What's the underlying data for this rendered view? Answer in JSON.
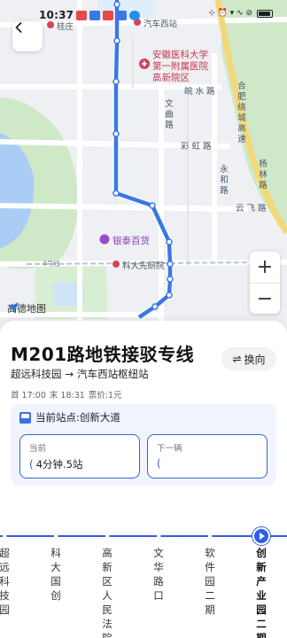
{
  "status_bar": {
    "time": "10:37",
    "right_text": "⊹ ⏰ ▾ ∿ ⊘"
  },
  "map": {
    "labels": {
      "guizhuang": "桂庄",
      "qiche_xizhan": "汽车西站",
      "hospital_line1": "安徽医科大学",
      "hospital_line2": "第一附属医院",
      "hospital_line3": "高新院区",
      "wanshui_road": "皖 水 路",
      "wenqu_road": "文曲路",
      "caihong_road": "彩 虹 路",
      "yonghe_road": "永和路",
      "hefei_ring": "合肥绕城高速",
      "yanglin_road": "杨林路",
      "yunfei_road": "云 飞 路",
      "yintai": "银泰百货",
      "kedaxian": "科大先研院",
      "line4": "4号线"
    },
    "logo_text": "高德地图",
    "zoom_in": "+",
    "zoom_out": "−"
  },
  "colors": {
    "route": "#3a78e6",
    "accent": "#2f5ee0",
    "park": "#cfe9c8",
    "water": "#a9cdf5",
    "highway": "#f3d878"
  },
  "route": {
    "title": "M201路地铁接驳专线",
    "switch_label": "换向",
    "switch_icon": "⇌",
    "from": "超远科技园",
    "arrow": "→",
    "to": "汽车西站枢纽站",
    "first_bus": "首 17:00",
    "last_bus": "末 18:31",
    "fare": "票价:1元"
  },
  "current_station": {
    "label": "当前站点:创新大道",
    "current_box": {
      "label": "当前",
      "value": "4分钟.5站"
    },
    "next_box": {
      "label": "下一辆",
      "value": ""
    }
  },
  "stops": [
    "超远科技园",
    "科大国创",
    "高新区人民法院",
    "文华路口",
    "软件园二期",
    "创新产业园二期"
  ]
}
